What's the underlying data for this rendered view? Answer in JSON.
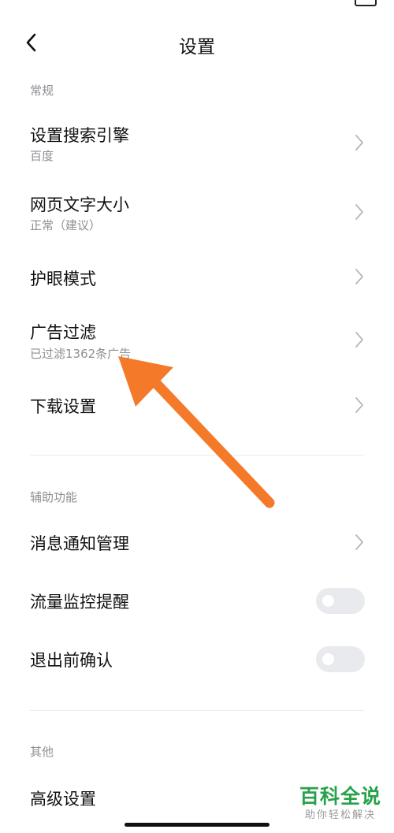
{
  "header": {
    "title": "设置"
  },
  "sections": {
    "general": {
      "label": "常规",
      "items": [
        {
          "title": "设置搜索引擎",
          "subtitle": "百度"
        },
        {
          "title": "网页文字大小",
          "subtitle": "正常（建议）"
        },
        {
          "title": "护眼模式"
        },
        {
          "title": "广告过滤",
          "subtitle": "已过滤1362条广告"
        },
        {
          "title": "下载设置"
        }
      ]
    },
    "accessibility": {
      "label": "辅助功能",
      "items": [
        {
          "title": "消息通知管理"
        },
        {
          "title": "流量监控提醒",
          "toggle": false
        },
        {
          "title": "退出前确认",
          "toggle": false
        }
      ]
    },
    "other": {
      "label": "其他",
      "items": [
        {
          "title": "高级设置"
        }
      ]
    }
  },
  "watermark": {
    "main": "百科全说",
    "sub": "助你轻松解决"
  },
  "colors": {
    "arrow": "#f47a2a",
    "watermark": "#27a24a",
    "secondary_text": "#8c8f94",
    "toggle_off": "#e9eaed"
  },
  "icons": {
    "back": "chevron-left",
    "row": "chevron-right"
  }
}
